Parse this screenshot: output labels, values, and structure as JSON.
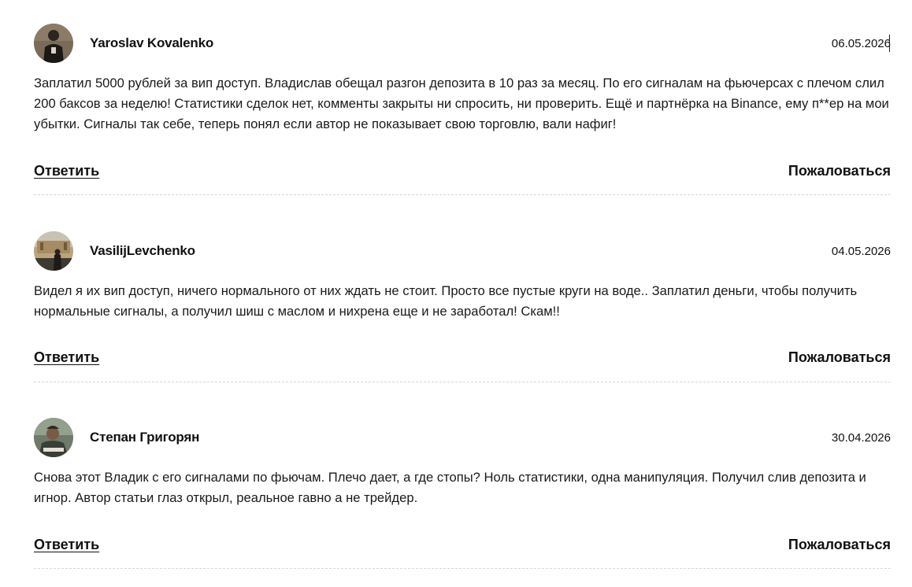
{
  "comments": [
    {
      "author": "Yaroslav Kovalenko",
      "date": "06.05.2026",
      "text": "Заплатил 5000 рублей за вип доступ. Владислав обещал разгон депозита в 10 раз за месяц. По его сигналам на фьючерсах с плечом слил 200 баксов за неделю! Статистики сделок нет, комменты закрыты ни спросить, ни проверить. Ещё и партнёрка на Binance, ему п**ер на мои убытки. Сигналы так себе, теперь понял если автор не показывает свою торговлю, вали нафиг!",
      "reply_label": "Ответить",
      "report_label": "Пожаловаться",
      "avatar_icon": "user-photo-avatar"
    },
    {
      "author": "VasilijLevchenko",
      "date": "04.05.2026",
      "text": "Видел я их вип доступ, ничего нормального от них ждать не стоит. Просто все пустые круги на воде.. Заплатил деньги, чтобы получить нормальные сигналы, а получил шиш с маслом и нихрена еще и не заработал! Скам!!",
      "reply_label": "Ответить",
      "report_label": "Пожаловаться",
      "avatar_icon": "user-photo-avatar"
    },
    {
      "author": "Степан Григорян",
      "date": "30.04.2026",
      "text": "Снова этот Владик с его сигналами по фьючам. Плечо дает, а где стопы? Ноль статистики, одна манипуляция. Получил слив депозита и игнор. Автор статьи глаз открыл, реальное гавно а не трейдер.",
      "reply_label": "Ответить",
      "report_label": "Пожаловаться",
      "avatar_icon": "user-photo-avatar"
    }
  ],
  "colors": {
    "text": "#111111",
    "divider": "#d6d6d6",
    "background": "#ffffff"
  }
}
